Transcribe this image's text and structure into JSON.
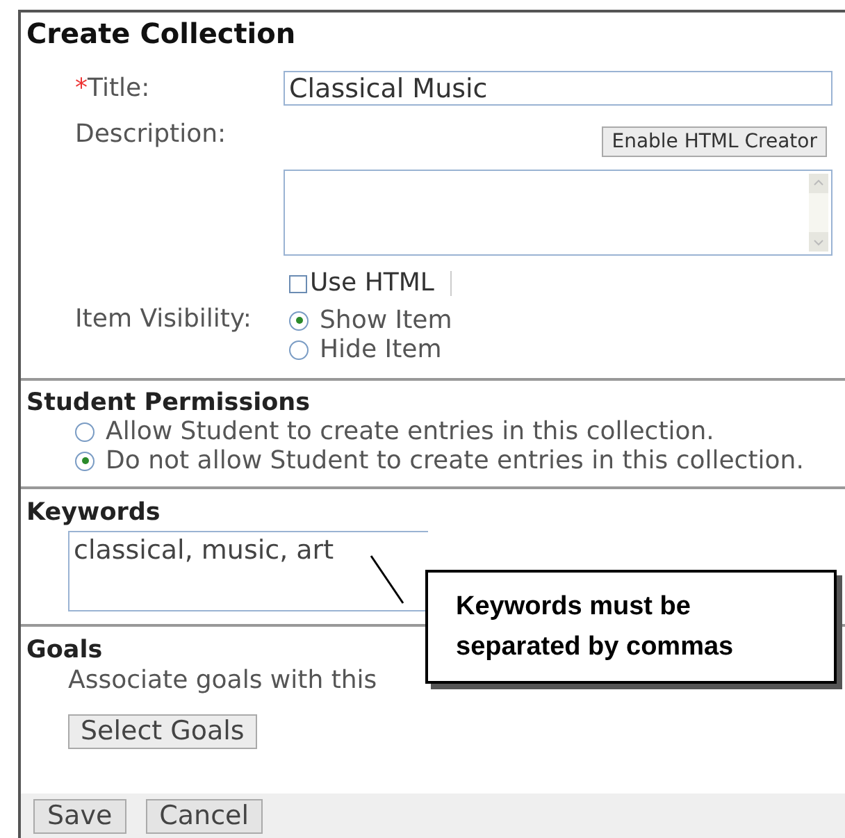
{
  "heading": "Create Collection",
  "title_field": {
    "required_mark": "*",
    "label": "Title:",
    "value": "Classical Music"
  },
  "description": {
    "label": "Description:",
    "button": "Enable HTML Creator",
    "use_html": {
      "label": "Use HTML",
      "checked": false
    }
  },
  "visibility": {
    "label": "Item Visibility:",
    "options": [
      {
        "label": "Show Item",
        "selected": true
      },
      {
        "label": "Hide Item",
        "selected": false
      }
    ]
  },
  "permissions": {
    "heading": "Student Permissions",
    "options": [
      {
        "label": "Allow Student to create entries in this collection.",
        "selected": false
      },
      {
        "label": "Do not allow Student to create entries in this collection.",
        "selected": true
      }
    ]
  },
  "keywords": {
    "heading": "Keywords",
    "value": "classical, music, art"
  },
  "goals": {
    "heading": "Goals",
    "text": "Associate goals with this",
    "button": "Select Goals"
  },
  "footer_buttons": [
    "Save",
    "Cancel"
  ],
  "callout": {
    "text": "Keywords must be separated by commas"
  }
}
